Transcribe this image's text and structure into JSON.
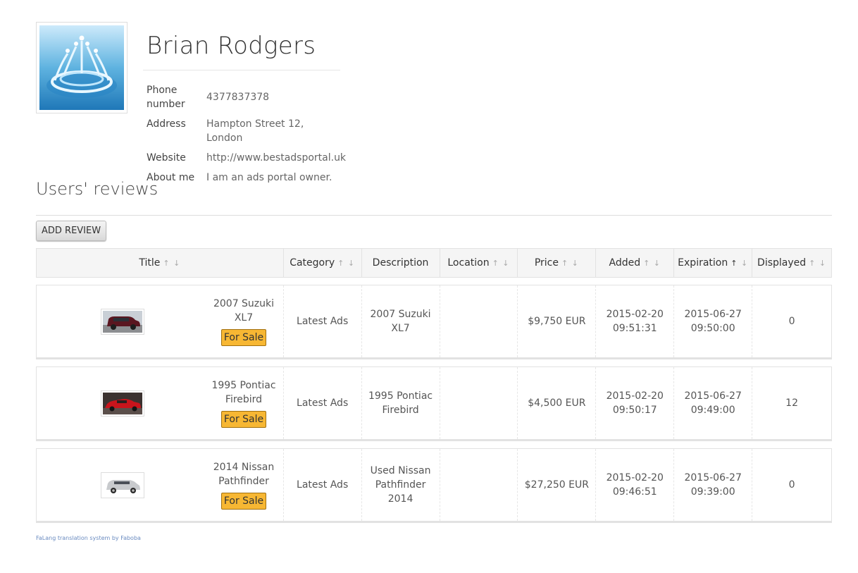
{
  "profile": {
    "name": "Brian Rodgers",
    "fields": [
      {
        "label": "Phone number",
        "value": "4377837378"
      },
      {
        "label": "Address",
        "value": "Hampton Street 12, London"
      },
      {
        "label": "Website",
        "value": "http://www.bestadsportal.uk"
      },
      {
        "label": "About me",
        "value": "I am an ads portal owner."
      }
    ]
  },
  "reviews": {
    "title": "Users' reviews",
    "add_button": "Add review"
  },
  "table": {
    "columns": [
      "Title",
      "Category",
      "Description",
      "Location",
      "Price",
      "Added",
      "Expiration",
      "Displayed"
    ],
    "sort_arrows": "↑ ↓",
    "rows": [
      {
        "title": "2007 Suzuki XL7",
        "badge": "For Sale",
        "category": "Latest Ads",
        "description": "2007 Suzuki XL7",
        "location": "",
        "price": "$9,750 EUR",
        "added": "2015-02-20 09:51:31",
        "expiration": "2015-06-27 09:50:00",
        "displayed": "0",
        "thumb_icon": "maroon-suv-photo"
      },
      {
        "title": "1995 Pontiac Firebird",
        "badge": "For Sale",
        "category": "Latest Ads",
        "description": "1995 Pontiac Firebird",
        "location": "",
        "price": "$4,500 EUR",
        "added": "2015-02-20 09:50:17",
        "expiration": "2015-06-27 09:49:00",
        "displayed": "12",
        "thumb_icon": "red-car-photo"
      },
      {
        "title": "2014 Nissan Pathfinder",
        "badge": "For Sale",
        "category": "Latest Ads",
        "description": "Used Nissan Pathfinder 2014",
        "location": "",
        "price": "$27,250 EUR",
        "added": "2015-02-20 09:46:51",
        "expiration": "2015-06-27 09:39:00",
        "displayed": "0",
        "thumb_icon": "silver-suv-photo"
      }
    ]
  },
  "footer": {
    "link": "FaLang translation system by Faboba"
  },
  "colors": {
    "badge": "#f7b733",
    "header_bg": "#f5f5f5",
    "border": "#e2e2e2"
  }
}
